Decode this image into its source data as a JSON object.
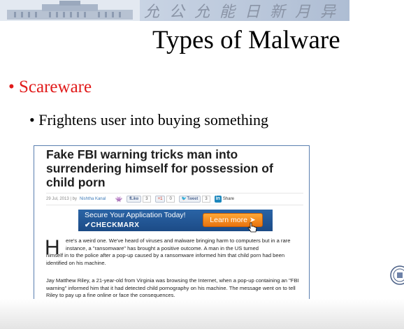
{
  "banner": {
    "motto": "允公允能日新月异"
  },
  "slide": {
    "title": "Types of Malware",
    "bullet_level1": "• Scareware",
    "bullet_level2": "• Frightens user into buying something"
  },
  "article": {
    "headline": "Fake FBI warning tricks man into surrendering himself for possession of child porn",
    "date": "29 Jul, 2013",
    "author_prefix": "by",
    "author": "Nishtha Kanal",
    "share": {
      "fb_label": "Like",
      "fb_count": "3",
      "gplus_label": "+1",
      "gplus_count": "0",
      "tweet_label": "Tweet",
      "tweet_count": "3",
      "linkedin_icon": "in",
      "linkedin_label": "Share"
    },
    "ad": {
      "line1": "Secure Your Application Today!",
      "brand": "✔CHECKMARX",
      "button": "Learn more ➤"
    },
    "dropcap": "H",
    "para1_start": "ere's a weird one. We've heard of viruses and malware bringing harm to computers but in a rare instance, a \"ransomware\" has brought a positive outcome. A man in the US turned",
    "para1_end": "himself in to the police after a pop-up caused by a ransomware informed him that child porn had been identified on his machine.",
    "para2": "Jay Matthew Riley, a 21-year-old from Virginia was browsing the Internet, when a pop-up containing an \"FBI warning\" informed him that it had detected child pornography on his machine. The message went on to tell Riley to pay up a fine online or face the consequences."
  }
}
